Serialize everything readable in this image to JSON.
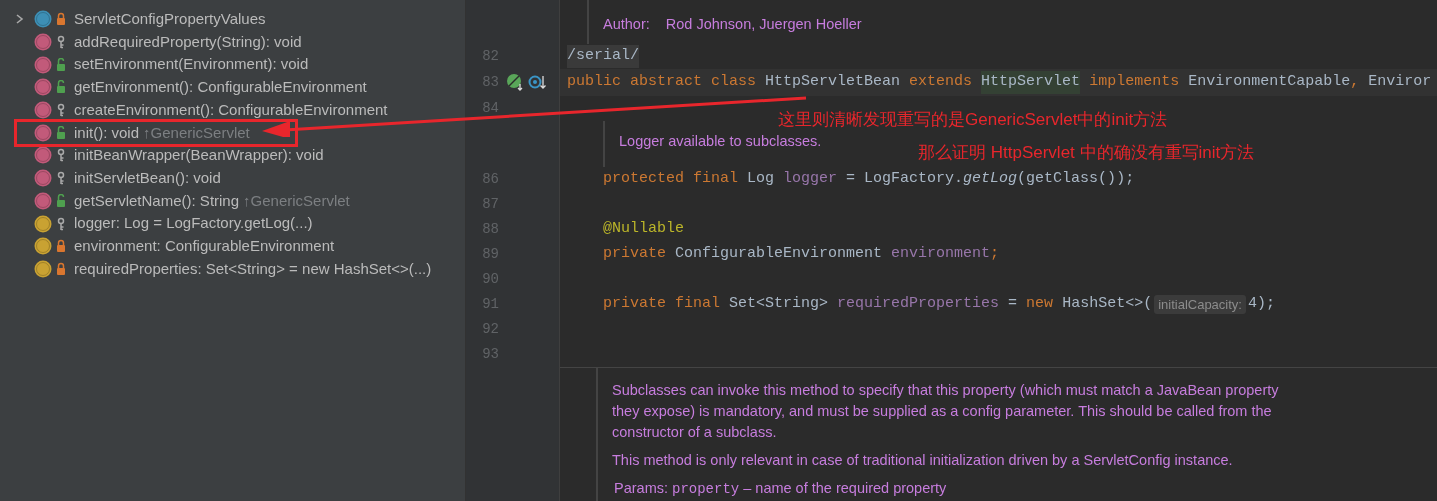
{
  "structure_panel": {
    "items": [
      {
        "kind": "class",
        "access": {
          "kind": "private"
        },
        "expandable": true,
        "name": "ServletConfigPropertyValues"
      },
      {
        "kind": "method",
        "access": {
          "kind": "protected"
        },
        "expandable": false,
        "name": "addRequiredProperty(String)",
        "type": ": void"
      },
      {
        "kind": "method",
        "access": {
          "kind": "public"
        },
        "expandable": false,
        "name": "setEnvironment(Environment)",
        "type": ": void"
      },
      {
        "kind": "method",
        "access": {
          "kind": "public"
        },
        "expandable": false,
        "name": "getEnvironment()",
        "type": ": ConfigurableEnvironment"
      },
      {
        "kind": "method",
        "access": {
          "kind": "protected"
        },
        "expandable": false,
        "name": "createEnvironment()",
        "type": ": ConfigurableEnvironment"
      },
      {
        "kind": "method",
        "access": {
          "kind": "public"
        },
        "expandable": false,
        "name": "init()",
        "type": ": void",
        "inherited_from": "↑GenericServlet"
      },
      {
        "kind": "method",
        "access": {
          "kind": "protected"
        },
        "expandable": false,
        "name": "initBeanWrapper(BeanWrapper)",
        "type": ": void"
      },
      {
        "kind": "method",
        "access": {
          "kind": "protected"
        },
        "expandable": false,
        "name": "initServletBean()",
        "type": ": void"
      },
      {
        "kind": "method",
        "access": {
          "kind": "public"
        },
        "expandable": false,
        "name": "getServletName()",
        "type": ": String",
        "inherited_from": "↑GenericServlet"
      },
      {
        "kind": "field",
        "access": {
          "kind": "protected"
        },
        "expandable": false,
        "name": "logger",
        "type": ": Log = LogFactory.getLog(...)"
      },
      {
        "kind": "field",
        "access": {
          "kind": "private"
        },
        "expandable": false,
        "name": "environment",
        "type": ": ConfigurableEnvironment"
      },
      {
        "kind": "field",
        "access": {
          "kind": "private"
        },
        "expandable": false,
        "name": "requiredProperties",
        "type": ": Set<String> = new HashSet<>(...)"
      }
    ]
  },
  "editor": {
    "blocks": [
      {
        "kind": "doc",
        "paragraphs": [
          [
            {
              "kind": "label",
              "text": "Author:"
            },
            {
              "kind": "text",
              "text": "Rod Johnson, Juergen Hoeller"
            }
          ]
        ]
      },
      {
        "kind": "code",
        "number": "82",
        "tokens": [
          {
            "kind": "folded",
            "text": "/serial/"
          }
        ]
      },
      {
        "kind": "code",
        "number": "83",
        "gutter_icons": true,
        "tokens": [
          {
            "kind": "keyword",
            "text": "public abstract class "
          },
          {
            "kind": "plain",
            "text": "HttpServletBean "
          },
          {
            "kind": "keyword",
            "text": "extends "
          },
          {
            "kind": "highlight",
            "text": "HttpServlet"
          },
          {
            "kind": "keyword",
            "text": " implements "
          },
          {
            "kind": "plain",
            "text": "EnvironmentCapable"
          },
          {
            "kind": "keyword",
            "text": ", "
          },
          {
            "kind": "plain",
            "text": "Enviror"
          }
        ]
      },
      {
        "kind": "code",
        "number": "84"
      },
      {
        "kind": "doc",
        "paragraphs": [
          [
            {
              "kind": "text",
              "text": "Logger available to subclasses."
            }
          ]
        ]
      },
      {
        "kind": "code",
        "number": "86",
        "tokens": [
          {
            "kind": "keyword",
            "text": "    protected final "
          },
          {
            "kind": "plain",
            "text": "Log "
          },
          {
            "kind": "field",
            "text": "logger"
          },
          {
            "kind": "plain",
            "text": " = LogFactory."
          },
          {
            "kind": "italic",
            "text": "getLog"
          },
          {
            "kind": "plain",
            "text": "(getClass());"
          }
        ]
      },
      {
        "kind": "code",
        "number": "87"
      },
      {
        "kind": "code",
        "number": "88",
        "tokens": [
          {
            "kind": "annotation",
            "text": "    @Nullable"
          }
        ]
      },
      {
        "kind": "code",
        "number": "89",
        "tokens": [
          {
            "kind": "keyword",
            "text": "    private "
          },
          {
            "kind": "plain",
            "text": "ConfigurableEnvironment "
          },
          {
            "kind": "field",
            "text": "environment"
          },
          {
            "kind": "keyword",
            "text": ";"
          }
        ]
      },
      {
        "kind": "code",
        "number": "90"
      },
      {
        "kind": "code",
        "number": "91",
        "tokens": [
          {
            "kind": "keyword",
            "text": "    private final "
          },
          {
            "kind": "plain",
            "text": "Set<String> "
          },
          {
            "kind": "field",
            "text": "requiredProperties"
          },
          {
            "kind": "plain",
            "text": " = "
          },
          {
            "kind": "keyword",
            "text": "new "
          },
          {
            "kind": "plain",
            "text": "HashSet<>("
          },
          {
            "kind": "hint",
            "text": "initialCapacity:"
          },
          {
            "kind": "plain",
            "text": "4);"
          }
        ]
      },
      {
        "kind": "code",
        "number": "92"
      },
      {
        "kind": "code",
        "number": "93"
      },
      {
        "kind": "doc",
        "paragraphs": [
          [
            {
              "kind": "text",
              "text": "Subclasses can invoke this method to specify that this property (which must match a JavaBean property they expose) is mandatory, and must be supplied as a config parameter. This should be called from the constructor of a subclass."
            }
          ],
          [
            {
              "kind": "text",
              "text": "This method is only relevant in case of traditional initialization driven by a ServletConfig instance."
            }
          ],
          [
            {
              "kind": "label",
              "text": "Params:"
            },
            {
              "kind": "code",
              "text": "property"
            },
            {
              "kind": "text",
              "text": "– name of the required property"
            }
          ]
        ]
      }
    ]
  },
  "annotations": {
    "notes": [
      "这里则清晰发现重写的是GenericServlet中的init方法",
      "那么证明 HttpServlet 中的确没有重写init方法"
    ]
  }
}
